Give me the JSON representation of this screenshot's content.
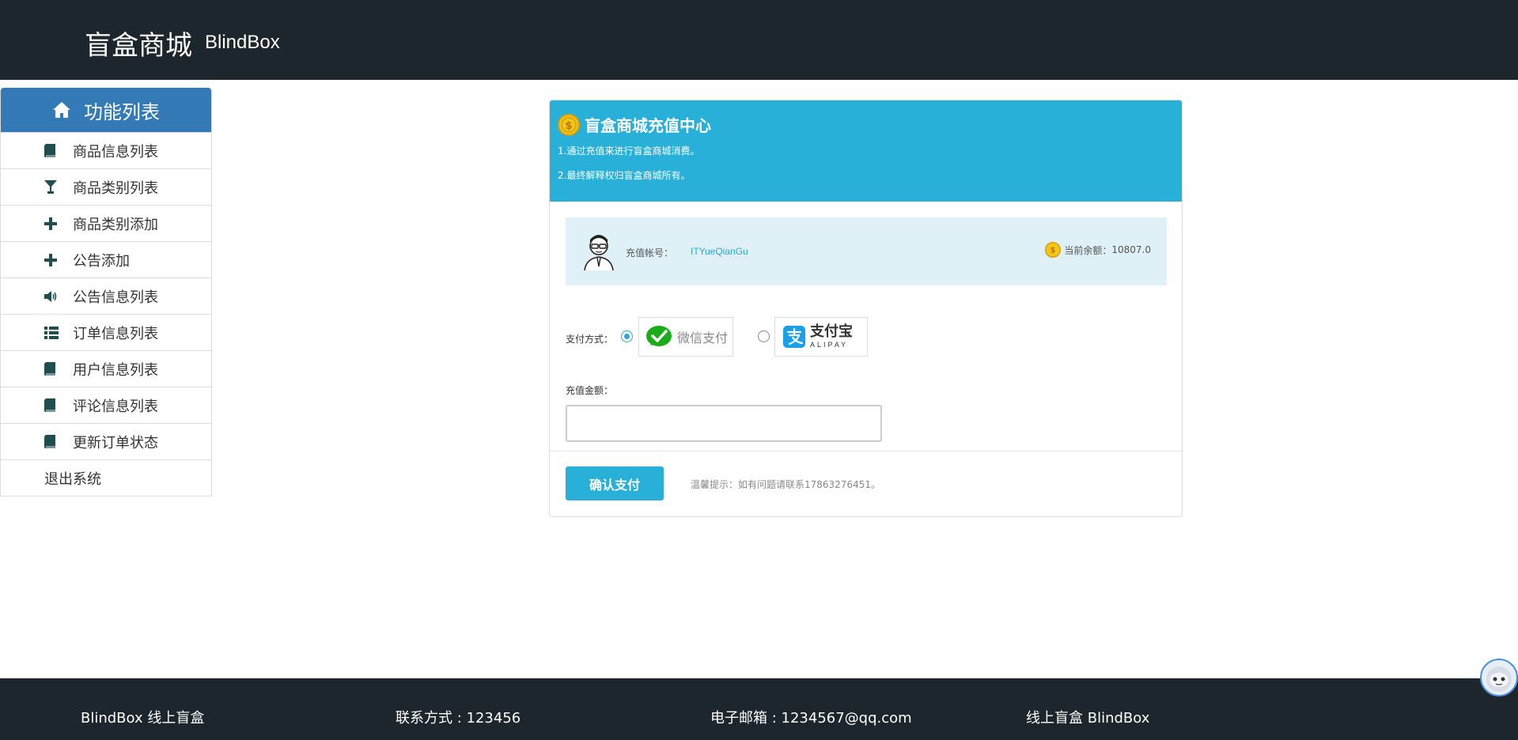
{
  "header": {
    "brand_cn": "盲盒商城",
    "brand_en": "BlindBox"
  },
  "sidebar": {
    "title": "功能列表",
    "title_icon": "home-icon",
    "items": [
      {
        "label": "商品信息列表",
        "icon": "book-icon"
      },
      {
        "label": "商品类别列表",
        "icon": "glass-icon"
      },
      {
        "label": "商品类别添加",
        "icon": "plus-icon"
      },
      {
        "label": "公告添加",
        "icon": "plus-icon"
      },
      {
        "label": "公告信息列表",
        "icon": "volume-icon"
      },
      {
        "label": "订单信息列表",
        "icon": "list-icon"
      },
      {
        "label": "用户信息列表",
        "icon": "book-icon"
      },
      {
        "label": "评论信息列表",
        "icon": "book-icon"
      },
      {
        "label": "更新订单状态",
        "icon": "book-icon"
      },
      {
        "label": "退出系统",
        "icon": ""
      }
    ]
  },
  "recharge": {
    "title": "盲盒商城充值中心",
    "notes": [
      "1.通过充值来进行盲盒商城消费。",
      "2.最终解释权归盲盒商城所有。"
    ],
    "account_label": "充值帐号：",
    "account_value": "ITYueQianGu",
    "balance_label": "当前余额：",
    "balance_value": "10807.0",
    "pay_method_label": "支付方式：",
    "wechat_label": "微信支付",
    "alipay_cn": "支付宝",
    "alipay_en": "ALIPAY",
    "selected_method": "wechat",
    "amount_label": "充值金额：",
    "amount_value": "",
    "confirm_label": "确认支付",
    "tip": "温馨提示：如有问题请联系17863276451。"
  },
  "footer": {
    "col1": "BlindBox 线上盲盒",
    "col2": "联系方式 : 123456",
    "col3": "电子邮箱 : 1234567@qq.com",
    "col4": "线上盲盒 BlindBox"
  },
  "colors": {
    "header_bg": "#1e262d",
    "sidebar_head": "#337ab7",
    "panel_head": "#29b0d9",
    "account_box": "#dff1f7",
    "accent": "#2aa7d6"
  }
}
